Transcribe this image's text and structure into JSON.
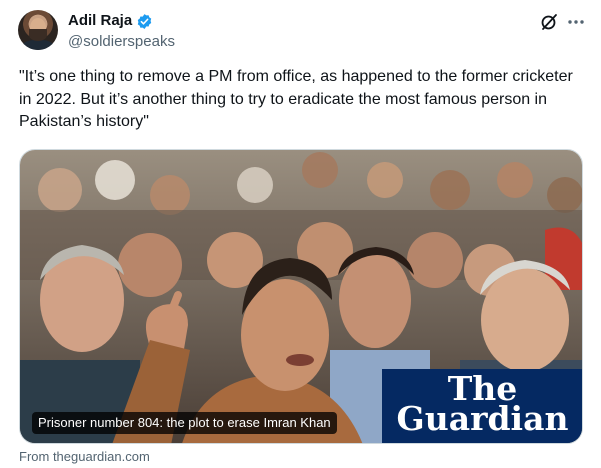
{
  "author": {
    "display_name": "Adil Raja",
    "handle": "@soldierspeaks",
    "verified": true
  },
  "icons": {
    "verified": "verified-badge-icon",
    "grok": "grok-slash-icon",
    "more": "more-options-icon"
  },
  "tweet": {
    "text": "\"It’s one thing to remove a PM from office, as happened to the former cricketer in 2022. But it’s another thing to try to eradicate the most famous person in Pakistan’s history\""
  },
  "card": {
    "caption": "Prisoner number 804: the plot to erase Imran Khan",
    "logo_line1": "The",
    "logo_line2": "Guardian",
    "source": "From theguardian.com"
  },
  "colors": {
    "verified_blue": "#1d9bf0",
    "guardian_navy": "#052962",
    "secondary_text": "#536471"
  }
}
